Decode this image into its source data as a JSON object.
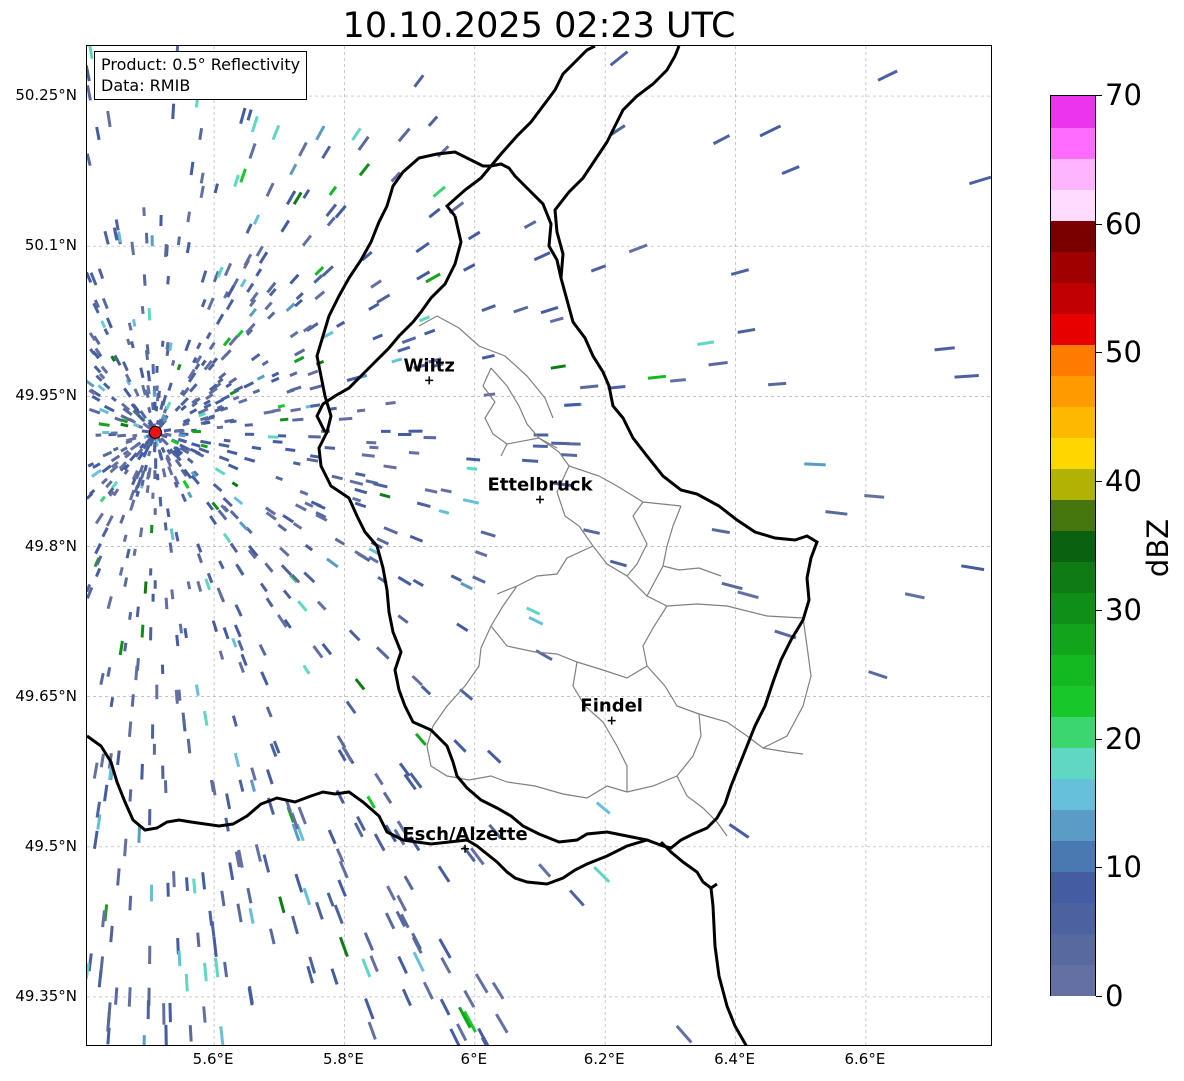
{
  "title": "10.10.2025 02:23 UTC",
  "info": {
    "product": "Product: 0.5° Reflectivity",
    "data": "Data: RMIB"
  },
  "axes": {
    "lat_ticks": [
      {
        "value": 50.25,
        "label": "50.25°N"
      },
      {
        "value": 50.1,
        "label": "50.1°N"
      },
      {
        "value": 49.95,
        "label": "49.95°N"
      },
      {
        "value": 49.8,
        "label": "49.8°N"
      },
      {
        "value": 49.65,
        "label": "49.65°N"
      },
      {
        "value": 49.5,
        "label": "49.5°N"
      },
      {
        "value": 49.35,
        "label": "49.35°N"
      }
    ],
    "lon_ticks": [
      {
        "value": 5.6,
        "label": "5.6°E"
      },
      {
        "value": 5.8,
        "label": "5.8°E"
      },
      {
        "value": 6.0,
        "label": "6°E"
      },
      {
        "value": 6.2,
        "label": "6.2°E"
      },
      {
        "value": 6.4,
        "label": "6.4°E"
      },
      {
        "value": 6.6,
        "label": "6.6°E"
      }
    ],
    "lon_range": [
      5.405,
      6.795
    ],
    "lat_range": [
      49.3,
      50.3
    ]
  },
  "cities": [
    {
      "name": "Wiltz",
      "lon": 5.93,
      "lat": 49.966
    },
    {
      "name": "Ettelbruck",
      "lon": 6.1,
      "lat": 49.847
    },
    {
      "name": "Findel",
      "lon": 6.21,
      "lat": 49.626
    },
    {
      "name": "Esch/Alzette",
      "lon": 5.985,
      "lat": 49.498
    }
  ],
  "radar_site": {
    "lon": 5.51,
    "lat": 49.914,
    "color": "#ee1111"
  },
  "colorbar": {
    "label": "dBZ",
    "min": 0,
    "max": 70,
    "step": 2.5,
    "tick_labels": [
      "0",
      "10",
      "20",
      "30",
      "40",
      "50",
      "60",
      "70"
    ],
    "tick_values": [
      0,
      10,
      20,
      30,
      40,
      50,
      60,
      70
    ],
    "colors": [
      "#6470a4",
      "#57699e",
      "#4c61a0",
      "#445ca2",
      "#4a78b0",
      "#5a9cc6",
      "#66c0dc",
      "#5ed8c2",
      "#3cd670",
      "#18c828",
      "#14b820",
      "#12a51c",
      "#108f18",
      "#0e7b14",
      "#0a6210",
      "#46760e",
      "#b0b204",
      "#ffd600",
      "#ffb800",
      "#ff9a00",
      "#ff7c00",
      "#e60000",
      "#c00000",
      "#a00000",
      "#7a0000",
      "#ffdcff",
      "#ffb4ff",
      "#ff6cff",
      "#ea34ee"
    ]
  }
}
